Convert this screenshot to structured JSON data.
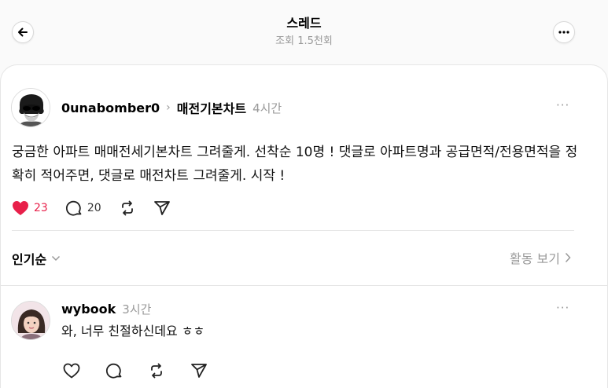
{
  "header": {
    "title": "스레드",
    "views": "조회 1.5천회"
  },
  "post": {
    "username": "0unabomber0",
    "topic": "매전기본차트",
    "time": "4시간",
    "text": "궁금한 아파트 매매전세기본차트 그려줄게. 선착순 10명 ! 댓글로 아파트명과 공급면적/전용면적을 정확히 적어주면, 댓글로 매전차트 그려줄게. 시작 !",
    "likes": "23",
    "comments": "20",
    "liked": true,
    "like_color": "#e8204a"
  },
  "sort": {
    "label": "인기순",
    "activity_label": "활동 보기"
  },
  "reply": {
    "username": "wybook",
    "time": "3시간",
    "text": "와, 너무 친절하신데요 ㅎㅎ"
  },
  "icons": {
    "back": "arrow-left-icon",
    "more": "more-horizontal-icon",
    "like": "heart-icon",
    "comment": "comment-icon",
    "repost": "repost-icon",
    "share": "send-icon"
  }
}
